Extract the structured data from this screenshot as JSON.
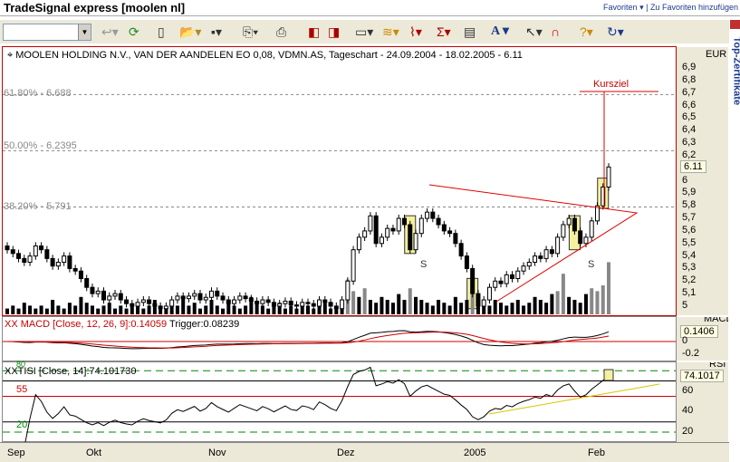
{
  "title": "TradeSignal express [moolen nl]",
  "favorites": {
    "menu": "Favoriten ▾",
    "add": "Zu Favoriten hinzufügen"
  },
  "sidebar_label": "Top-Zertifikate",
  "chart_header": "MOOLEN HOLDING N.V., VAN DER AANDELEN EO 0,08, VDMN.AS, Tageschart - 24.09.2004 - 18.02.2005 - 6.11",
  "currency": "EUR",
  "price_ticks": [
    "6,9",
    "6,8",
    "6,7",
    "6,6",
    "6,5",
    "6,4",
    "6,3",
    "6,2",
    "6",
    "5,9",
    "5,8",
    "5,7",
    "5,6",
    "5,5",
    "5,4",
    "5,3",
    "5,2",
    "5,1",
    "5"
  ],
  "last_price": "6.11",
  "fib": [
    {
      "label": "61.80% - 6.688",
      "value": 6.688
    },
    {
      "label": "50.00% - 6.2395",
      "value": 6.2395
    },
    {
      "label": "38.20% - 5.791",
      "value": 5.791
    }
  ],
  "annotations": {
    "target": "Kursziel",
    "s1": "S",
    "s2": "S"
  },
  "macd": {
    "header": "XX MACD [Close, 12, 26, 9]:0.14059",
    "trigger": "Trigger:0.08239",
    "scale_title": "MACD",
    "value": "0.1406",
    "ticks": [
      "0",
      "-0.2"
    ]
  },
  "rsi": {
    "header": "XXTISI [Close, 14]:74.101730",
    "scale_title": "RSI",
    "value": "74.1017",
    "ticks": [
      "60",
      "40",
      "20"
    ],
    "level_80": "80",
    "level_55": "55",
    "level_20": "20"
  },
  "months": [
    "Sep",
    "Okt",
    "Nov",
    "Dez",
    "2005",
    "Feb"
  ],
  "colors": {
    "frame": "#c00000",
    "fib": "#888888",
    "trend": "#e00000",
    "rsi_trend": "#d4c800",
    "box": "#f4f0a0"
  },
  "closes": [
    5.45,
    5.42,
    5.38,
    5.35,
    5.4,
    5.48,
    5.45,
    5.38,
    5.32,
    5.35,
    5.4,
    5.3,
    5.28,
    5.22,
    5.15,
    5.1,
    5.12,
    5.05,
    5.08,
    5.1,
    5.05,
    5.02,
    5.0,
    5.03,
    5.05,
    5.02,
    5.0,
    4.98,
    5.0,
    5.05,
    5.08,
    5.06,
    5.08,
    5.1,
    5.05,
    5.07,
    5.12,
    5.08,
    5.05,
    5.02,
    5.05,
    5.08,
    5.06,
    5.04,
    5.02,
    5.05,
    5.03,
    5.0,
    5.02,
    5.04,
    5.01,
    5.0,
    5.03,
    5.02,
    5.0,
    5.05,
    5.03,
    5.0,
    4.98,
    5.05,
    5.2,
    5.45,
    5.55,
    5.6,
    5.72,
    5.5,
    5.55,
    5.62,
    5.6,
    5.7,
    5.65,
    5.45,
    5.58,
    5.7,
    5.75,
    5.7,
    5.65,
    5.6,
    5.58,
    5.5,
    5.4,
    5.3,
    5.1,
    5.0,
    5.05,
    5.15,
    5.2,
    5.18,
    5.25,
    5.22,
    5.28,
    5.32,
    5.35,
    5.4,
    5.38,
    5.45,
    5.42,
    5.55,
    5.65,
    5.7,
    5.6,
    5.5,
    5.55,
    5.68,
    5.8,
    5.95,
    6.11
  ],
  "volumes": [
    2,
    3,
    2,
    4,
    3,
    2,
    3,
    2,
    5,
    3,
    2,
    4,
    3,
    6,
    4,
    3,
    2,
    3,
    4,
    2,
    3,
    2,
    3,
    4,
    2,
    3,
    5,
    3,
    2,
    4,
    3,
    6,
    3,
    4,
    2,
    3,
    5,
    3,
    2,
    4,
    3,
    2,
    3,
    6,
    4,
    3,
    2,
    3,
    4,
    2,
    3,
    2,
    4,
    3,
    2,
    3,
    4,
    2,
    3,
    5,
    12,
    8,
    6,
    9,
    5,
    4,
    6,
    5,
    4,
    7,
    5,
    9,
    6,
    5,
    4,
    3,
    5,
    4,
    3,
    6,
    4,
    5,
    9,
    6,
    4,
    3,
    5,
    4,
    3,
    4,
    5,
    3,
    4,
    6,
    5,
    4,
    7,
    8,
    14,
    6,
    5,
    4,
    7,
    9,
    8,
    10,
    18
  ]
}
